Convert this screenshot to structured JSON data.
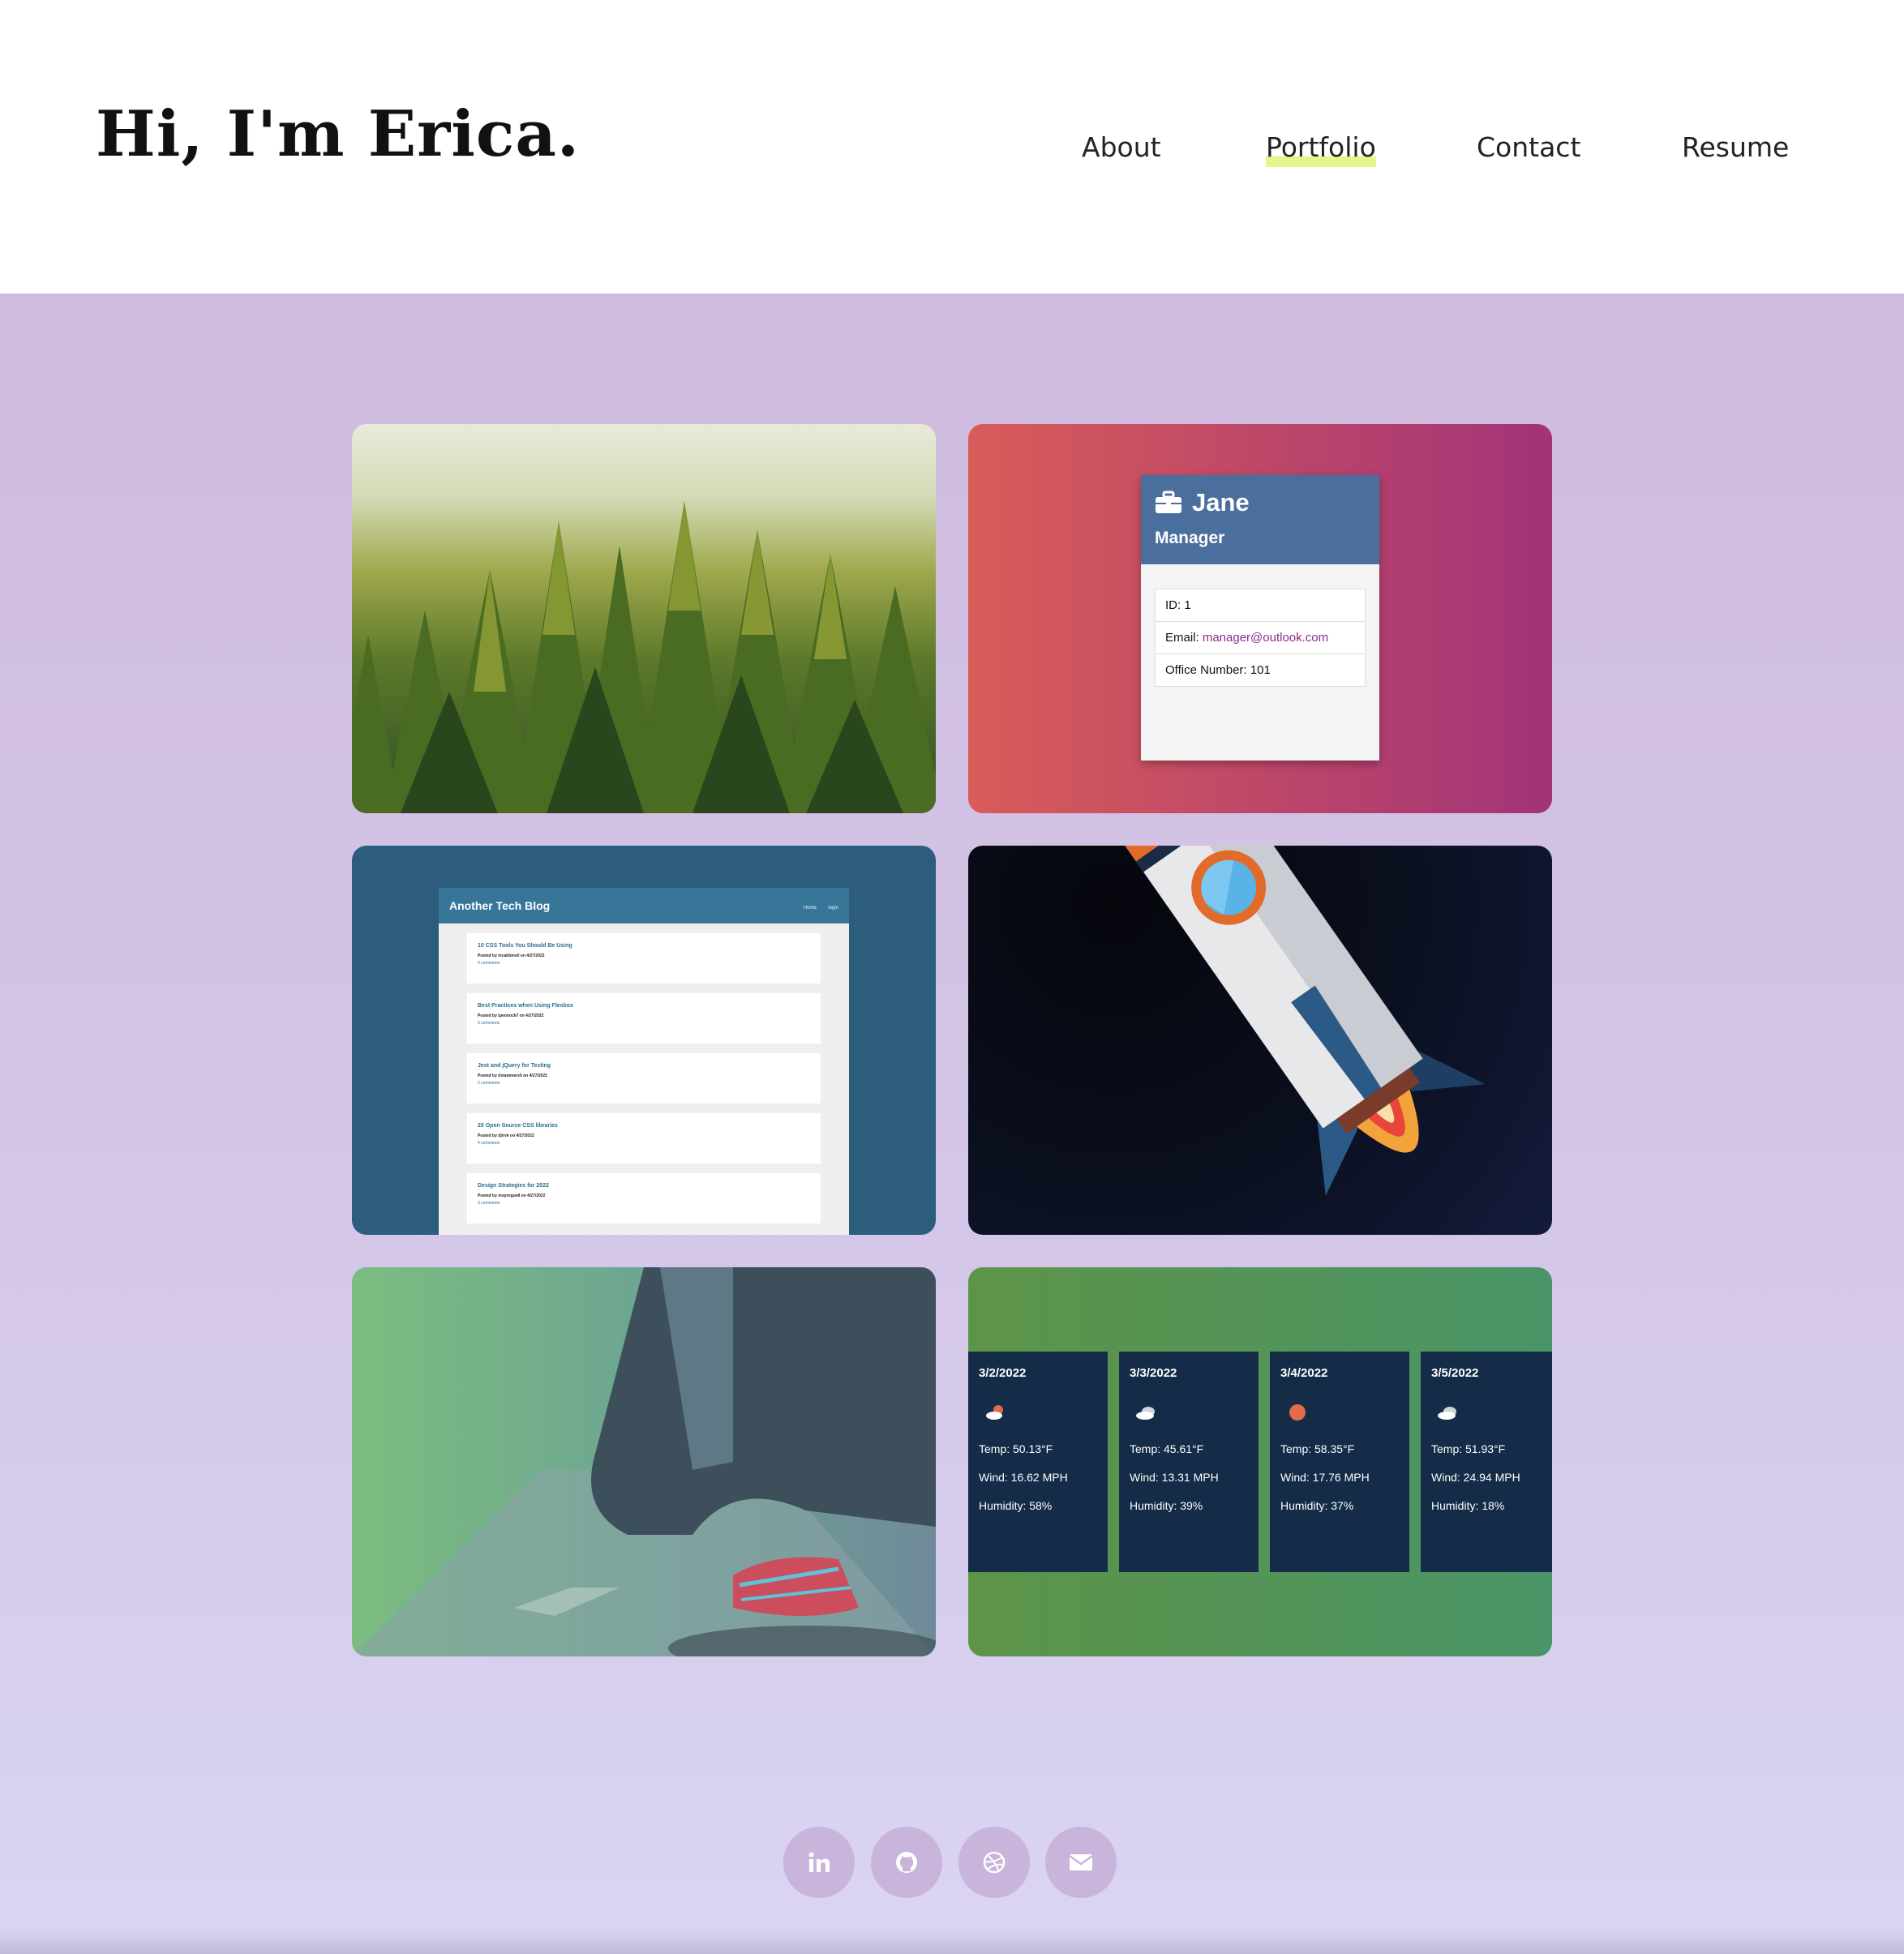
{
  "header": {
    "title": "Hi, I'm Erica.",
    "nav": [
      {
        "label": "About"
      },
      {
        "label": "Portfolio",
        "active": true
      },
      {
        "label": "Contact"
      },
      {
        "label": "Resume"
      }
    ],
    "active_underline_color": "#e3f78e"
  },
  "portfolio": {
    "employee_card": {
      "name": "Jane",
      "role": "Manager",
      "id_line": "ID: 1",
      "email_label": "Email: ",
      "email": "manager@outlook.com",
      "office_line": "Office Number: 101"
    },
    "blog": {
      "title": "Another Tech Blog",
      "nav": [
        "Home",
        "login"
      ],
      "posts": [
        {
          "title": "10 CSS Tools You Should Be Using",
          "meta": "Posted by mcabbins0 on 4/27/2022",
          "comments": "4 comments"
        },
        {
          "title": "Best Practices when Using Flexbox",
          "meta": "Posted by tpennock7 on 4/27/2022",
          "comments": "3 comments"
        },
        {
          "title": "Jest and jQuery for Testing",
          "meta": "Posted by dstammers5 on 4/27/2022",
          "comments": "2 comments"
        },
        {
          "title": "20 Open Source CSS libraries",
          "meta": "Posted by djirvk on 4/27/2022",
          "comments": "4 comments"
        },
        {
          "title": "Design Strategies for 2022",
          "meta": "Posted by msprogue8 on 4/27/2022",
          "comments": "3 comments"
        }
      ]
    },
    "weather": {
      "days": [
        {
          "date": "3/2/2022",
          "icon": "partly-cloudy-icon",
          "temp": "Temp: 50.13°F",
          "wind": "Wind: 16.62 MPH",
          "humidity": "Humidity: 58%"
        },
        {
          "date": "3/3/2022",
          "icon": "cloud-icon",
          "temp": "Temp: 45.61°F",
          "wind": "Wind: 13.31 MPH",
          "humidity": "Humidity: 39%"
        },
        {
          "date": "3/4/2022",
          "icon": "sun-icon",
          "temp": "Temp: 58.35°F",
          "wind": "Wind: 17.76 MPH",
          "humidity": "Humidity: 37%"
        },
        {
          "date": "3/5/2022",
          "icon": "cloud-icon",
          "temp": "Temp: 51.93°F",
          "wind": "Wind: 24.94 MPH",
          "humidity": "Humidity: 18%"
        }
      ]
    }
  },
  "footer": {
    "social_icons": [
      "linkedin-icon",
      "github-icon",
      "dribbble-icon",
      "email-icon"
    ]
  }
}
